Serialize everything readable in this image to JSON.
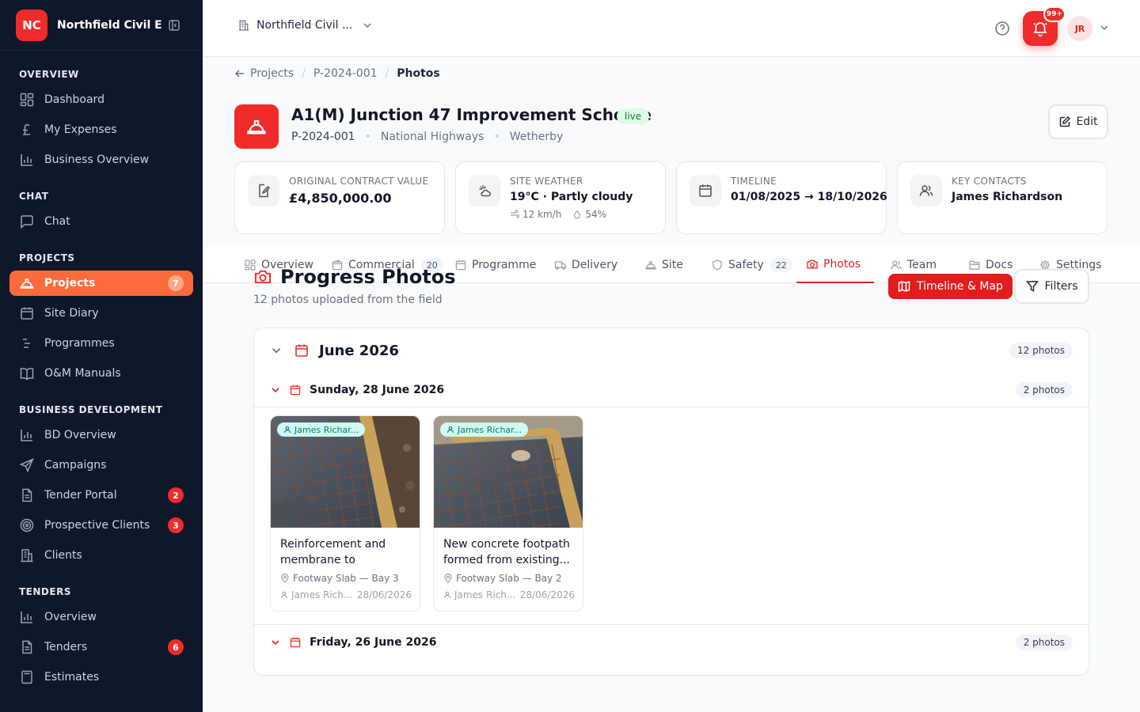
{
  "sidebar": {
    "logo": "NC",
    "org_name": "Northfield Civil E...",
    "sections": [
      {
        "title": "OVERVIEW",
        "items": [
          {
            "label": "Dashboard",
            "icon": "dashboard-icon"
          },
          {
            "label": "My Expenses",
            "icon": "pound-icon"
          },
          {
            "label": "Business Overview",
            "icon": "bar-chart-icon"
          }
        ]
      },
      {
        "title": "CHAT",
        "items": [
          {
            "label": "Chat",
            "icon": "chat-icon"
          }
        ]
      },
      {
        "title": "PROJECTS",
        "items": [
          {
            "label": "Projects",
            "icon": "hard-hat-icon",
            "badge": "7",
            "active": true
          },
          {
            "label": "Site Diary",
            "icon": "calendar-icon"
          },
          {
            "label": "Programmes",
            "icon": "gantt-icon"
          },
          {
            "label": "O&M Manuals",
            "icon": "book-icon"
          }
        ]
      },
      {
        "title": "BUSINESS DEVELOPMENT",
        "items": [
          {
            "label": "BD Overview",
            "icon": "bar-chart-icon"
          },
          {
            "label": "Campaigns",
            "icon": "send-icon"
          },
          {
            "label": "Tender Portal",
            "icon": "document-icon",
            "badge": "2"
          },
          {
            "label": "Prospective Clients",
            "icon": "target-icon",
            "badge": "3"
          },
          {
            "label": "Clients",
            "icon": "building-icon"
          }
        ]
      },
      {
        "title": "TENDERS",
        "items": [
          {
            "label": "Overview",
            "icon": "bar-chart-icon"
          },
          {
            "label": "Tenders",
            "icon": "document-icon",
            "badge": "6"
          },
          {
            "label": "Estimates",
            "icon": "calculator-icon"
          }
        ]
      }
    ]
  },
  "topbar": {
    "org_switch": "Northfield Civil ...",
    "notifications_badge": "99+",
    "avatar_initials": "JR"
  },
  "breadcrumb": {
    "items": [
      "Projects",
      "P-2024-001",
      "Photos"
    ]
  },
  "project": {
    "title": "A1(M) Junction 47 Improvement Scheme",
    "status": "live",
    "code": "P-2024-001",
    "client": "National Highways",
    "location": "Wetherby",
    "edit_label": "Edit"
  },
  "stats": [
    {
      "label": "ORIGINAL CONTRACT VALUE",
      "value": "£4,850,000.00",
      "icon": "contract-edit-icon"
    },
    {
      "label": "SITE WEATHER",
      "value": "19°C · Partly cloudy",
      "wind": "12 km/h",
      "humidity": "54%",
      "icon": "weather-icon"
    },
    {
      "label": "TIMELINE",
      "value": "01/08/2025 → 18/10/2026",
      "icon": "calendar-icon"
    },
    {
      "label": "KEY CONTACTS",
      "value": "James Richardson",
      "icon": "users-icon"
    }
  ],
  "tabs": [
    {
      "label": "Overview",
      "icon": "dashboard-icon"
    },
    {
      "label": "Commercial",
      "icon": "wallet-icon",
      "count": "20"
    },
    {
      "label": "Programme",
      "icon": "calendar-icon"
    },
    {
      "label": "Delivery",
      "icon": "truck-icon"
    },
    {
      "label": "Site",
      "icon": "hard-hat-icon"
    },
    {
      "label": "Safety",
      "icon": "shield-icon",
      "count": "22"
    },
    {
      "label": "Photos",
      "icon": "camera-icon",
      "active": true
    },
    {
      "label": "Team",
      "icon": "users-icon"
    },
    {
      "label": "Docs",
      "icon": "folder-icon"
    },
    {
      "label": "Settings",
      "icon": "gear-icon"
    }
  ],
  "photos": {
    "title": "Progress Photos",
    "subtitle": "12 photos uploaded from the field",
    "timeline_button": "Timeline & Map",
    "filters_button": "Filters",
    "month": {
      "label": "June 2026",
      "count": "12 photos"
    },
    "days": [
      {
        "label": "Sunday, 28 June 2026",
        "count": "2 photos",
        "photos": [
          {
            "author_chip": "James Richar...",
            "caption": "Reinforcement and membrane to footway...",
            "location": "Footway Slab — Bay 3",
            "author": "James Rich...",
            "date": "28/06/2026"
          },
          {
            "author_chip": "James Richar...",
            "caption": "New concrete footpath formed from existing...",
            "location": "Footway Slab — Bay 2",
            "author": "James Rich...",
            "date": "28/06/2026"
          }
        ]
      },
      {
        "label": "Friday, 26 June 2026",
        "count": "2 photos",
        "photos": []
      }
    ]
  },
  "colors": {
    "brand": "#ef2b2b",
    "sidebar_bg": "#0f172a",
    "active_nav": "#fb6b3c",
    "live_bg": "#dcfce7"
  }
}
